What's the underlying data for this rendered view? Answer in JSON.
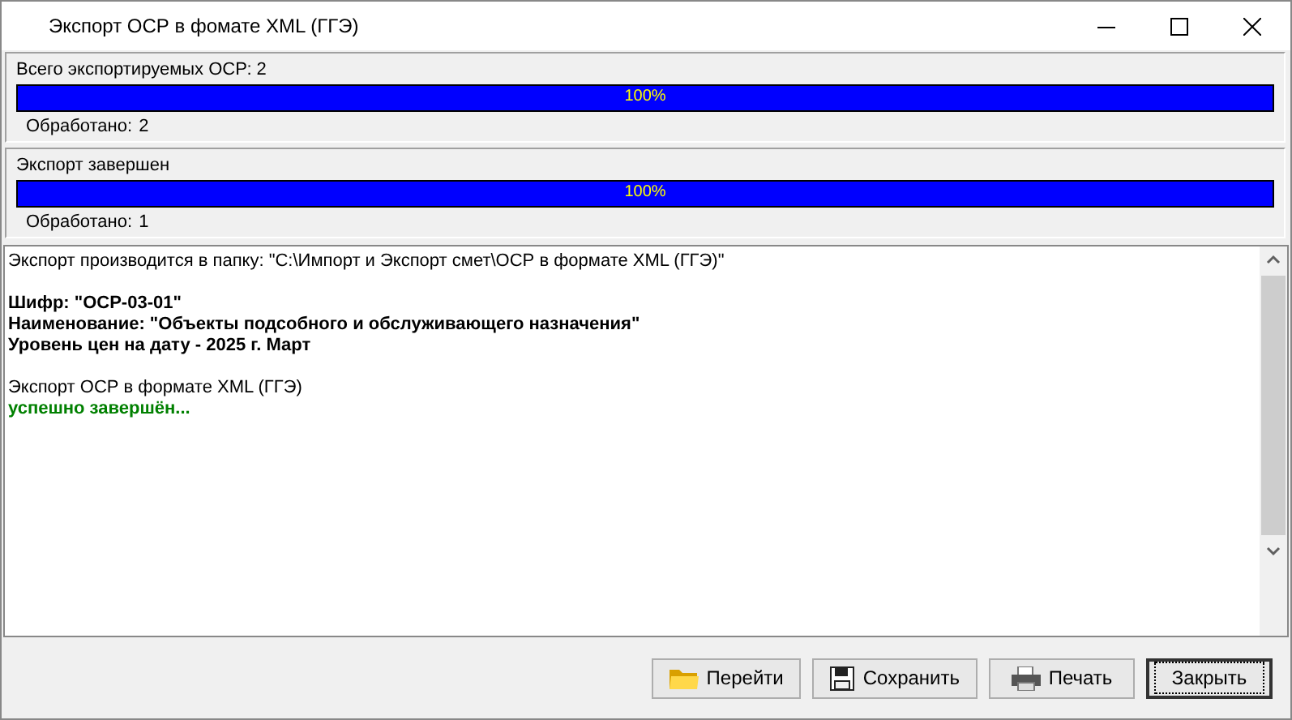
{
  "window": {
    "title": "Экспорт ОСР в фомате XML (ГГЭ)"
  },
  "progress_panels": [
    {
      "caption": "Всего экспортируемых ОСР: 2",
      "level": 1,
      "reading": "100%",
      "processed_label": "Обработано:",
      "processed_count": "2"
    },
    {
      "caption": "Экспорт завершен",
      "level": 1,
      "reading": "100%",
      "processed_label": "Обработано:",
      "processed_count": "1"
    }
  ],
  "log_paragraphs": [
    {
      "lines": [
        {
          "kind": "plain",
          "text": "Экспорт производится в папку: \"C:\\Импорт и Экспорт смет\\ОСР в формате XML (ГГЭ)\""
        }
      ]
    },
    {
      "lines": [
        {
          "kind": "bold",
          "text": "Шифр: \"ОСР-03-01\""
        },
        {
          "kind": "bold",
          "text": "Наименование: \"Объекты подсобного и обслуживающего назначения\""
        },
        {
          "kind": "bold",
          "text": "Уровень цен на дату - 2025 г. Март"
        }
      ]
    },
    {
      "lines": [
        {
          "kind": "plain",
          "text": "Экспорт ОСР в формате XML (ГГЭ)"
        },
        {
          "kind": "success",
          "text": "успешно завершён..."
        }
      ]
    }
  ],
  "buttons": [
    {
      "label": "Перейти",
      "kind": "folder",
      "focused": false
    },
    {
      "label": "Сохранить",
      "kind": "floppy",
      "focused": false
    },
    {
      "label": "Печать",
      "kind": "printer",
      "focused": false
    },
    {
      "label": "Закрыть",
      "kind": "plain",
      "focused": true
    }
  ]
}
